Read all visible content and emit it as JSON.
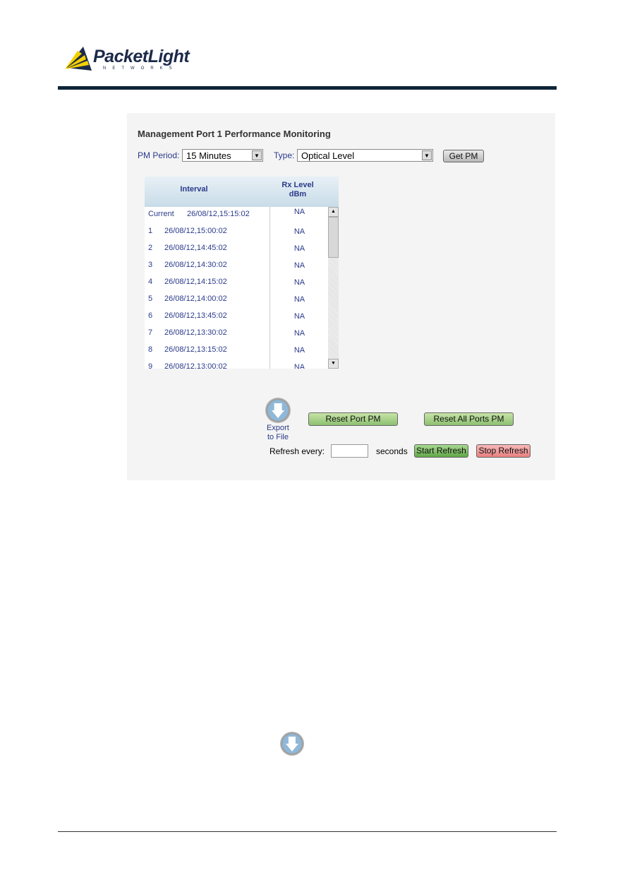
{
  "logo": {
    "brand": "PacketLight",
    "tm": "TM",
    "sub": "NETWORKS"
  },
  "panel": {
    "title": "Management Port 1 Performance Monitoring",
    "pm_period_label": "PM Period:",
    "pm_period_value": "15 Minutes",
    "type_label": "Type:",
    "type_value": "Optical Level",
    "get_pm": "Get PM"
  },
  "table": {
    "headers": [
      "Interval",
      "Rx Level",
      "dBm"
    ],
    "rows": [
      {
        "idx": "Current",
        "time": "26/08/12,15:15:02",
        "rx": "NA"
      },
      {
        "idx": "1",
        "time": "26/08/12,15:00:02",
        "rx": "NA"
      },
      {
        "idx": "2",
        "time": "26/08/12,14:45:02",
        "rx": "NA"
      },
      {
        "idx": "3",
        "time": "26/08/12,14:30:02",
        "rx": "NA"
      },
      {
        "idx": "4",
        "time": "26/08/12,14:15:02",
        "rx": "NA"
      },
      {
        "idx": "5",
        "time": "26/08/12,14:00:02",
        "rx": "NA"
      },
      {
        "idx": "6",
        "time": "26/08/12,13:45:02",
        "rx": "NA"
      },
      {
        "idx": "7",
        "time": "26/08/12,13:30:02",
        "rx": "NA"
      },
      {
        "idx": "8",
        "time": "26/08/12,13:15:02",
        "rx": "NA"
      },
      {
        "idx": "9",
        "time": "26/08/12,13:00:02",
        "rx": "NA"
      }
    ]
  },
  "actions": {
    "export_line1": "Export",
    "export_line2": "to File",
    "reset_port": "Reset Port PM",
    "reset_all": "Reset All Ports PM",
    "refresh_label": "Refresh every:",
    "refresh_value": "",
    "seconds": "seconds",
    "start": "Start Refresh",
    "stop": "Stop Refresh"
  }
}
